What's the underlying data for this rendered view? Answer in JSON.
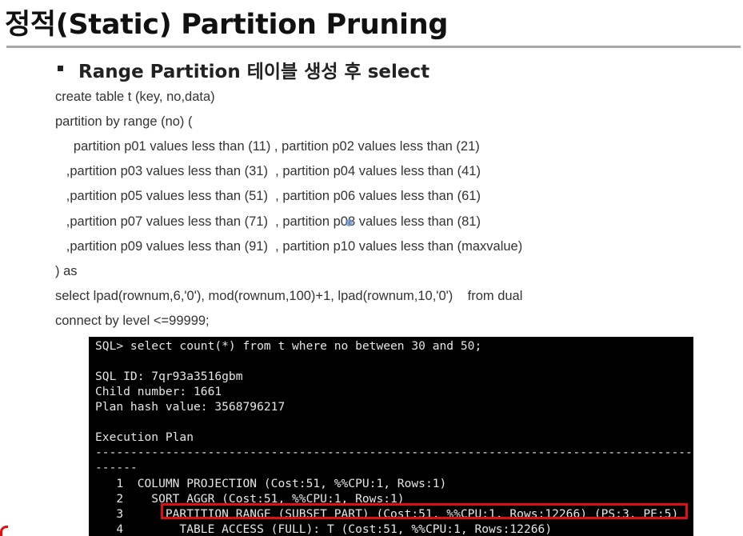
{
  "title": "정적(Static) Partition Pruning",
  "subtitle": "Range Partition 테이블 생성 후 select",
  "code_lines": [
    "create table t (key, no,data)",
    "partition by range (no) (",
    "     partition p01 values less than (11) , partition p02 values less than (21)",
    "   ,partition p03 values less than (31)  , partition p04 values less than (41)",
    "   ,partition p05 values less than (51)  , partition p06 values less than (61)",
    "   ,partition p07 values less than (71)  , partition p08 values less than (81)",
    "   ,partition p09 values less than (91)  , partition p10 values less than (maxvalue)",
    ") as",
    "select lpad(rownum,6,'0'), mod(rownum,100)+1, lpad(rownum,10,'0')    from dual",
    "connect by level <=99999;"
  ],
  "terminal": {
    "query": "SQL> select count(*) from t where no between 30 and 50;",
    "sql_id": "SQL ID: 7qr93a3516gbm",
    "child_number": "Child number: 1661",
    "plan_hash": "Plan hash value: 3568796217",
    "plan_heading": "Execution Plan",
    "dash_line": "--------------------------------------------------------------------------------------------------------",
    "dash_short": "------",
    "plan_rows": [
      "   1  COLUMN PROJECTION (Cost:51, %%CPU:1, Rows:1)",
      "   2    SORT AGGR (Cost:51, %%CPU:1, Rows:1)",
      "   3      PARTITION RANGE (SUBSET PART) (Cost:51, %%CPU:1, Rows:12266) (PS:3, PE:5)",
      "   4        TABLE ACCESS (FULL): T (Cost:51, %%CPU:1, Rows:12266)"
    ],
    "highlighted_row": 3
  }
}
